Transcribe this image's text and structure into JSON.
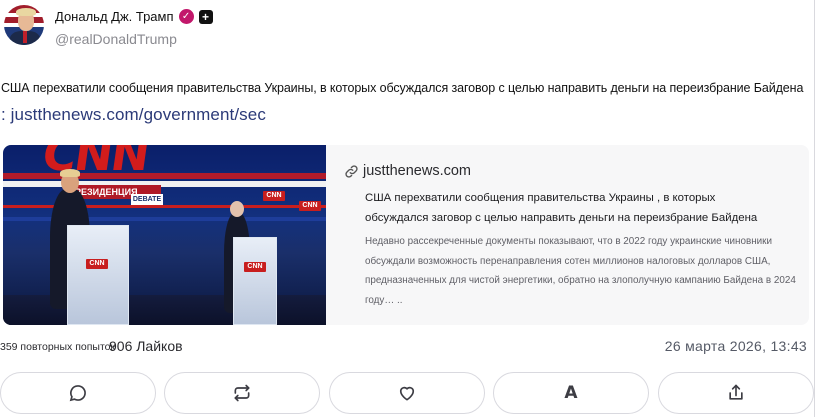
{
  "author": {
    "display_name": "Дональд Дж. Трамп",
    "handle": "@realDonaldTrump",
    "avatar_icon": "avatar-photo",
    "verified_icon": "verified-check-icon",
    "badge_icon": "plus-badge-icon",
    "verified_color": "#c2186b"
  },
  "post": {
    "text": "США перехватили сообщения правительства Украины, в которых обсуждался заговор с целью направить деньги на переизбрание Байдена",
    "link_text": ": justthenews.com/government/sec",
    "link_color": "#2b3a78"
  },
  "preview": {
    "domain": "justthenews.com",
    "domain_icon": "link-icon",
    "title": "США перехватили сообщения правительства Украины , в которых обсуждался заговор с целью направить деньги на переизбрание Байдена",
    "description": "Недавно рассекреченные документы показывают, что в 2022 году украинские чиновники обсуждали возможность перенаправления сотен миллионов налоговых долларов США, предназначенных для чистой энергетики, обратно на злополучную кампанию Байдена в 2024 году… ..",
    "image": {
      "logo_text": "CNN",
      "banner_text": "РЕЗИДЕНЦИЯ",
      "debate_text": "DEBATE",
      "podium_logo": "CNN"
    }
  },
  "stats": {
    "reposts": "359 повторных попыток",
    "likes": "906 Лайков",
    "date": "26 марта 2026, 13:43"
  },
  "actions": [
    {
      "name": "reply-button",
      "icon": "reply-icon"
    },
    {
      "name": "repost-button",
      "icon": "repost-icon"
    },
    {
      "name": "like-button",
      "icon": "heart-icon"
    },
    {
      "name": "font-button",
      "icon": "font-icon",
      "label": "A"
    },
    {
      "name": "share-button",
      "icon": "share-icon"
    }
  ]
}
